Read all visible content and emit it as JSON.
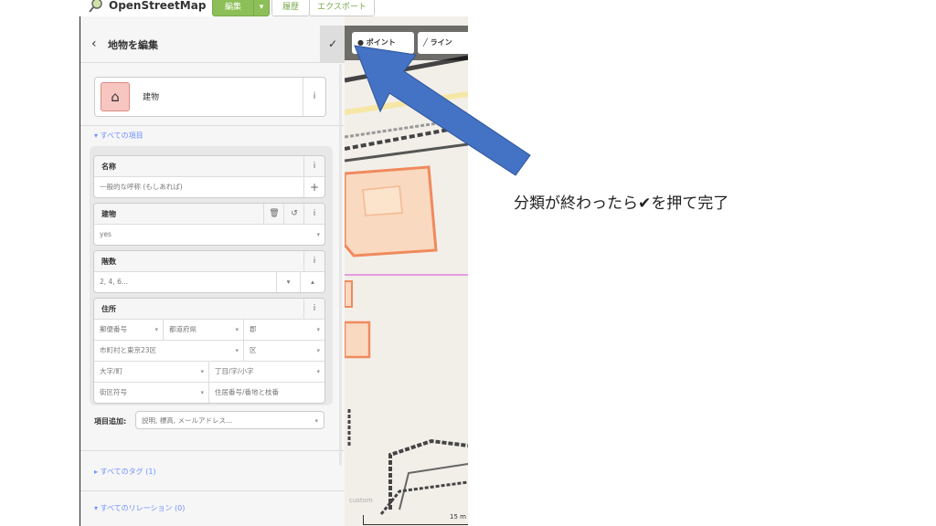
{
  "app": {
    "logo_text": "OpenStreetMap",
    "edit_label": "編集",
    "edit_dropdown": "▾",
    "history_label": "履歴",
    "export_label": "エクスポート"
  },
  "editor": {
    "back_glyph": "‹",
    "title": "地物を編集",
    "done_glyph": "✓",
    "preset": {
      "icon_glyph": "⌂",
      "label": "建物",
      "info": "i"
    },
    "all_fields_toggle": "▾ すべての項目",
    "fields": {
      "name": {
        "label": "名称",
        "placeholder": "一般的な呼称 (もしあれば)",
        "info": "i",
        "add": "+"
      },
      "building": {
        "label": "建物",
        "value": "yes",
        "delete": "🗑",
        "undo": "↺",
        "info": "i"
      },
      "levels": {
        "label": "階数",
        "placeholder": "2, 4, 6...",
        "info": "i"
      },
      "address": {
        "label": "住所",
        "info": "i",
        "postcode": "郵便番号",
        "prefecture": "都道府県",
        "county": "郡",
        "city": "市町村と東京23区",
        "ward": "区",
        "neighbourhood": "大字/町",
        "quarter": "丁目/字/小字",
        "block": "街区符号",
        "housenumber": "住居番号/番地と枝番"
      }
    },
    "add_field": {
      "label": "項目追加:",
      "placeholder": "説明, 標高, メールアドレス..."
    },
    "all_tags_toggle": "▸ すべてのタグ (1)",
    "all_relations_toggle": "▾ すべてのリレーション (0)",
    "caret": "▾",
    "caret_up": "▴"
  },
  "map": {
    "point_label": "ポイント",
    "line_label": "ライン",
    "attribution": "custom",
    "scale": "15 m"
  },
  "annotation": {
    "text": "分類が終わったら✔を押て完了",
    "arrow_color": "#4472c4"
  }
}
